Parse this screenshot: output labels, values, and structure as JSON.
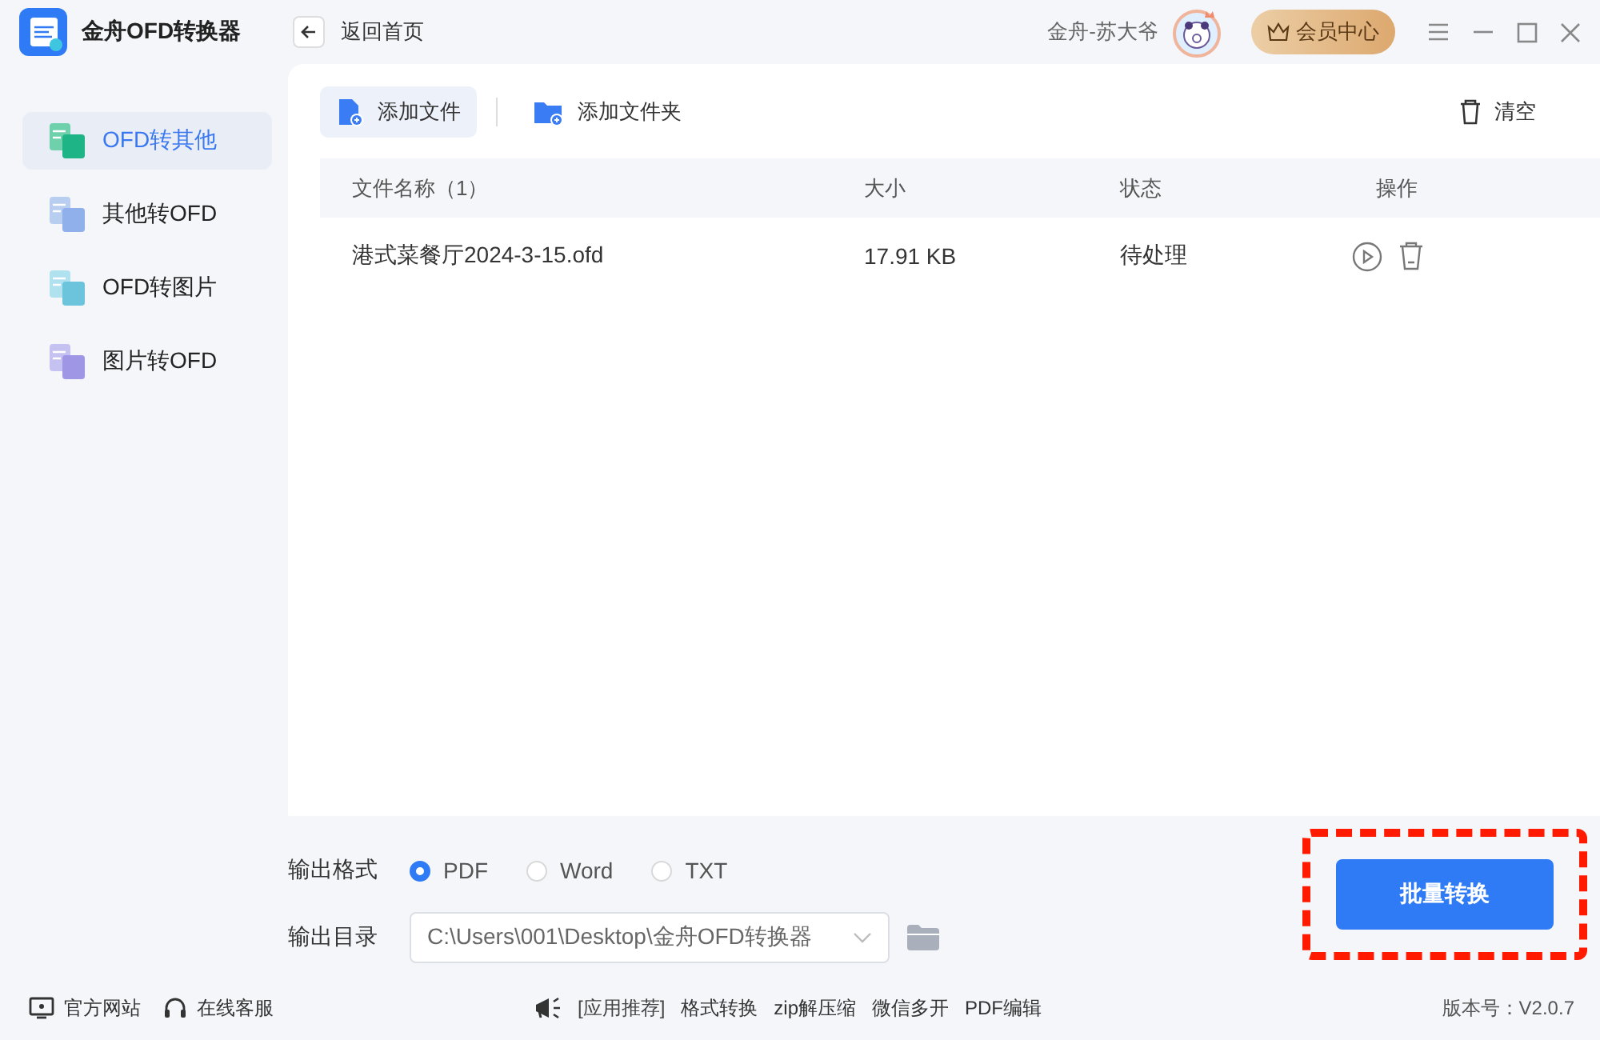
{
  "app": {
    "title": "金舟OFD转换器",
    "back_label": "返回首页",
    "user_name": "金舟-苏大爷",
    "vip_label": "会员中心"
  },
  "sidebar": {
    "items": [
      {
        "label": "OFD转其他",
        "selected": true
      },
      {
        "label": "其他转OFD",
        "selected": false
      },
      {
        "label": "OFD转图片",
        "selected": false
      },
      {
        "label": "图片转OFD",
        "selected": false
      }
    ]
  },
  "toolbar": {
    "add_file": "添加文件",
    "add_folder": "添加文件夹",
    "clear": "清空"
  },
  "table": {
    "columns": [
      "文件名称（1）",
      "大小",
      "状态",
      "操作"
    ],
    "rows": [
      {
        "name": "港式菜餐厅2024-3-15.ofd",
        "size": "17.91 KB",
        "status": "待处理"
      }
    ]
  },
  "output": {
    "format_label": "输出格式",
    "formats": [
      {
        "label": "PDF",
        "selected": true
      },
      {
        "label": "Word",
        "selected": false
      },
      {
        "label": "TXT",
        "selected": false
      }
    ],
    "dir_label": "输出目录",
    "dir_value": "C:\\Users\\001\\Desktop\\金舟OFD转换器"
  },
  "convert_button": {
    "label": "批量转换",
    "highlighted": true
  },
  "footer": {
    "links": [
      "官方网站",
      "在线客服"
    ],
    "apps_label": "[应用推荐]",
    "apps": [
      "格式转换",
      "zip解压缩",
      "微信多开",
      "PDF编辑"
    ],
    "version": "版本号：V2.0.7"
  }
}
